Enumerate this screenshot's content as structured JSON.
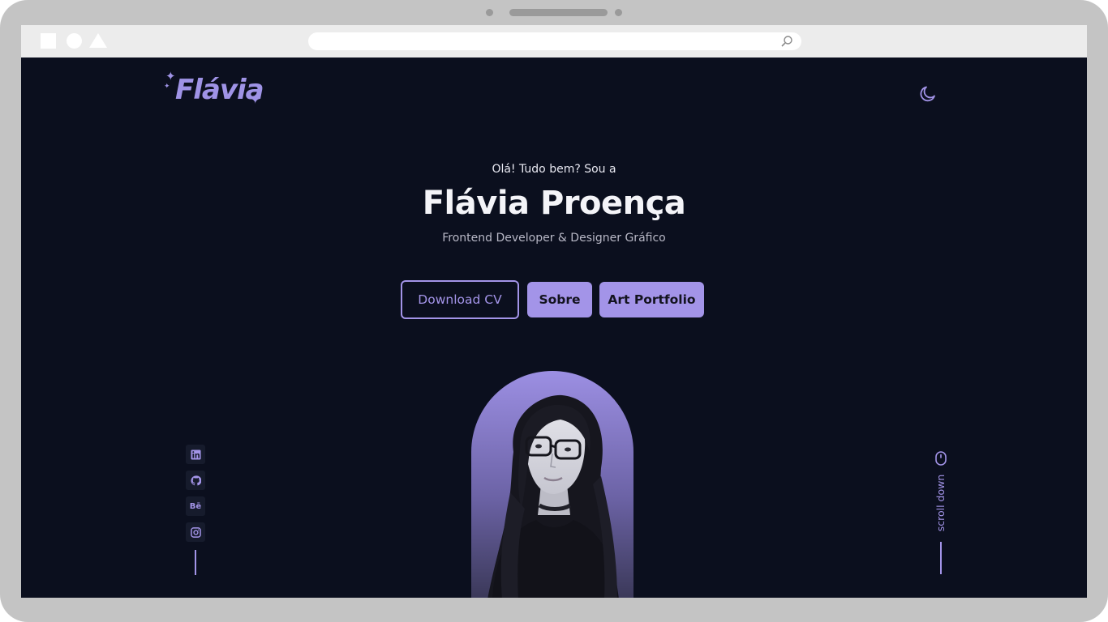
{
  "browser": {
    "url": ""
  },
  "header": {
    "logo_text": "Flávia",
    "theme_toggle_icon": "moon-icon"
  },
  "hero": {
    "greeting": "Olá! Tudo bem? Sou a",
    "name": "Flávia Proença",
    "role": "Frontend Developer & Designer Gráfico"
  },
  "buttons": {
    "download_cv": "Download CV",
    "sobre": "Sobre",
    "art_portfolio": "Art Portfolio"
  },
  "social": {
    "linkedin_icon": "linkedin-icon",
    "github_icon": "github-icon",
    "behance_text": "Bē",
    "instagram_icon": "instagram-icon"
  },
  "scroll": {
    "label": "scroll down",
    "icon": "mouse-icon"
  },
  "colors": {
    "background": "#0b0f1e",
    "accent": "#a394e8",
    "text": "#f4f4f8"
  }
}
